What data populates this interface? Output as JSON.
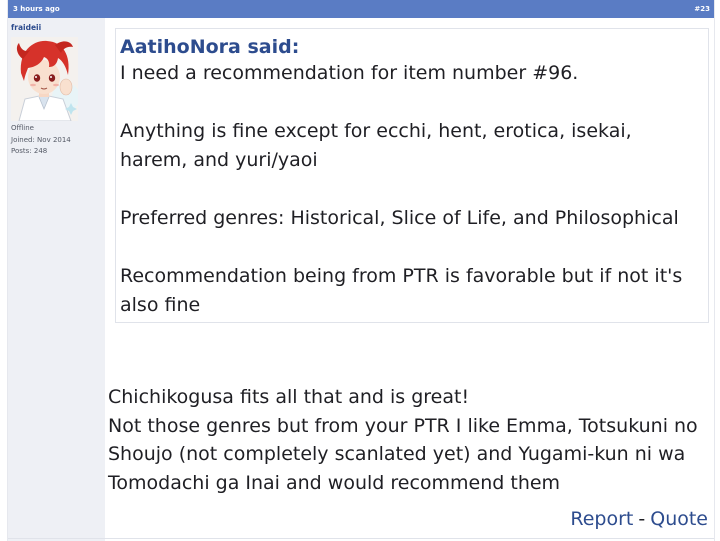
{
  "post": {
    "time": "3 hours ago",
    "number": "#23"
  },
  "user": {
    "name": "fraideii",
    "status": "Offline",
    "joined": "Joined: Nov 2014",
    "posts": "Posts: 248",
    "avatar_icon": "anime-avatar"
  },
  "quote": {
    "author": "AatihoNora said:",
    "lines": [
      "I need a recommendation for item number #96.",
      "Anything is fine except for ecchi, hent, erotica, isekai, harem, and yuri/yaoi",
      "Preferred genres: Historical, Slice of Life, and Philosophical",
      "Recommendation being from PTR is favorable but if not it's also fine"
    ]
  },
  "reply": {
    "lines": [
      "Chichikogusa fits all that and is great!",
      "Not those genres but from your PTR I like Emma, Totsukuni no",
      "Shoujo (not completely scanlated yet) and Yugami-kun ni wa",
      "Tomodachi ga Inai and would recommend them"
    ]
  },
  "actions": {
    "report": "Report",
    "separator": "-",
    "quote": "Quote"
  },
  "colors": {
    "header": "#5a7cc4",
    "link": "#2d4c8e",
    "sidebar": "#eef0f5"
  }
}
